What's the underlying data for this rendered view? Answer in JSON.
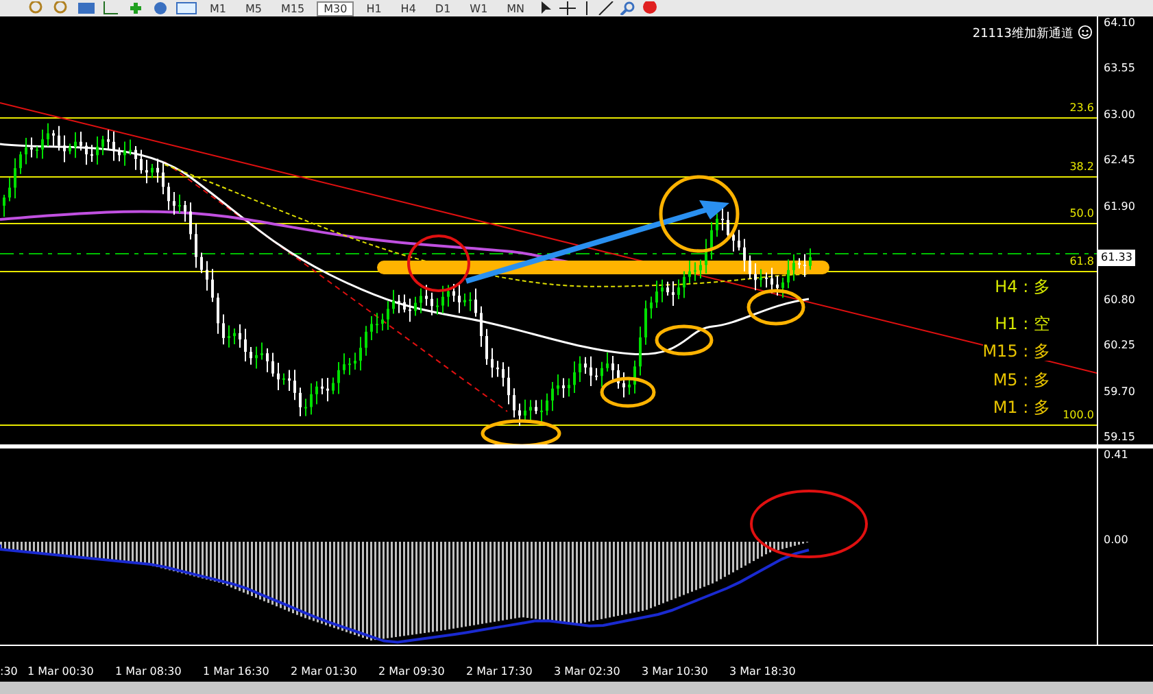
{
  "toolbar": {
    "timeframes": [
      {
        "label": "M1",
        "selected": false
      },
      {
        "label": "M5",
        "selected": false
      },
      {
        "label": "M15",
        "selected": false
      },
      {
        "label": "M30",
        "selected": true
      },
      {
        "label": "H1",
        "selected": false
      },
      {
        "label": "H4",
        "selected": false
      },
      {
        "label": "D1",
        "selected": false
      },
      {
        "label": "W1",
        "selected": false
      },
      {
        "label": "MN",
        "selected": false
      }
    ]
  },
  "chart": {
    "info_text": "21113维加新通道",
    "fib_levels": [
      "23.6",
      "38.2",
      "50.0",
      "61.8",
      "100.0"
    ],
    "price_axis": [
      "64.10",
      "63.55",
      "63.00",
      "62.45",
      "61.90",
      "60.80",
      "60.25",
      "59.70",
      "59.15"
    ],
    "current_price": "61.33",
    "signals": [
      {
        "label": "H4 : 多",
        "color": "#d4e600"
      },
      {
        "label": "H1 : 空",
        "color": "#d4e600"
      },
      {
        "label": "M15 : 多",
        "color": "#e8c400"
      },
      {
        "label": "M5 : 多",
        "color": "#e8c400"
      },
      {
        "label": "M1 : 多",
        "color": "#e8c400"
      }
    ]
  },
  "indicator": {
    "axis": [
      "0.41",
      "0.00"
    ]
  },
  "time_axis": [
    ":30",
    "1 Mar 00:30",
    "1 Mar 08:30",
    "1 Mar 16:30",
    "2 Mar 01:30",
    "2 Mar 09:30",
    "2 Mar 17:30",
    "3 Mar 02:30",
    "3 Mar 10:30",
    "3 Mar 18:30"
  ]
}
